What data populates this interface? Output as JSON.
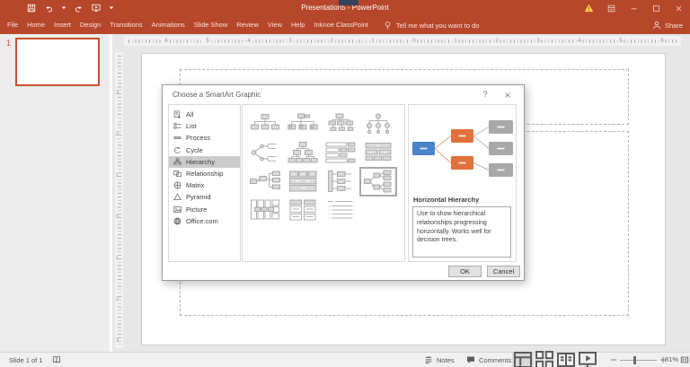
{
  "titlebar": {
    "title": "Presentation5 - PowerPoint"
  },
  "ribbon": {
    "tabs": [
      "File",
      "Home",
      "Insert",
      "Design",
      "Transitions",
      "Animations",
      "Slide Show",
      "Review",
      "View",
      "Help",
      "Inknoe ClassPoint"
    ],
    "tell_me": "Tell me what you want to do",
    "share_label": "Share"
  },
  "slides_panel": {
    "slide_number": "1"
  },
  "rulers": {
    "horizontal": [
      "6",
      "5",
      "4",
      "3",
      "2",
      "1",
      "0",
      "1",
      "2",
      "3",
      "4",
      "5",
      "6"
    ],
    "vertical": [
      "3",
      "2",
      "1",
      "0",
      "1",
      "2",
      "3"
    ]
  },
  "dialog": {
    "title": "Choose a SmartArt Graphic",
    "help_label": "?",
    "categories": [
      {
        "label": "All",
        "icon": "all"
      },
      {
        "label": "List",
        "icon": "list"
      },
      {
        "label": "Process",
        "icon": "process"
      },
      {
        "label": "Cycle",
        "icon": "cycle"
      },
      {
        "label": "Hierarchy",
        "icon": "hierarchy",
        "selected": true
      },
      {
        "label": "Relationship",
        "icon": "relationship"
      },
      {
        "label": "Matrix",
        "icon": "matrix"
      },
      {
        "label": "Pyramid",
        "icon": "pyramid"
      },
      {
        "label": "Picture",
        "icon": "picture"
      },
      {
        "label": "Office.com",
        "icon": "office-com"
      }
    ],
    "thumbnails": [
      {
        "name": "organization-chart",
        "type": "org-chart"
      },
      {
        "name": "name-and-title-organization-chart",
        "type": "name-title-org"
      },
      {
        "name": "half-circle-organization-chart",
        "type": "half-circle-org"
      },
      {
        "name": "circle-picture-hierarchy",
        "type": "circle-hierarchy"
      },
      {
        "name": "horizontal-multi-level-hierarchy",
        "type": "multilevel-circles"
      },
      {
        "name": "hierarchy",
        "type": "hierarchy"
      },
      {
        "name": "labeled-hierarchy",
        "type": "labeled-hierarchy"
      },
      {
        "name": "table-hierarchy",
        "type": "table-hierarchy"
      },
      {
        "name": "horizontal-organization-chart",
        "type": "horizontal-org"
      },
      {
        "name": "block-hierarchy",
        "type": "block-hierarchy"
      },
      {
        "name": "vertical-labeled-hierarchy",
        "type": "vertical-labeled"
      },
      {
        "name": "horizontal-hierarchy",
        "type": "horizontal-hierarchy",
        "selected": true
      },
      {
        "name": "architecture-layout",
        "type": "architecture-grid"
      },
      {
        "name": "hierarchy-list",
        "type": "hierarchy-list"
      },
      {
        "name": "lined-list",
        "type": "lined-list"
      }
    ],
    "preview": {
      "name": "Horizontal Hierarchy",
      "description": "Use to show hierarchical relationships progressing horizontally. Works well for decision trees.",
      "colors": {
        "blue": "#4A84C8",
        "orange": "#E0713C",
        "gray": "#A8A8A8"
      }
    },
    "ok_label": "OK",
    "cancel_label": "Cancel"
  },
  "statusbar": {
    "slide_indicator": "Slide 1 of 1",
    "notes_label": "Notes",
    "comments_label": "Comments",
    "zoom_level": "81%"
  }
}
